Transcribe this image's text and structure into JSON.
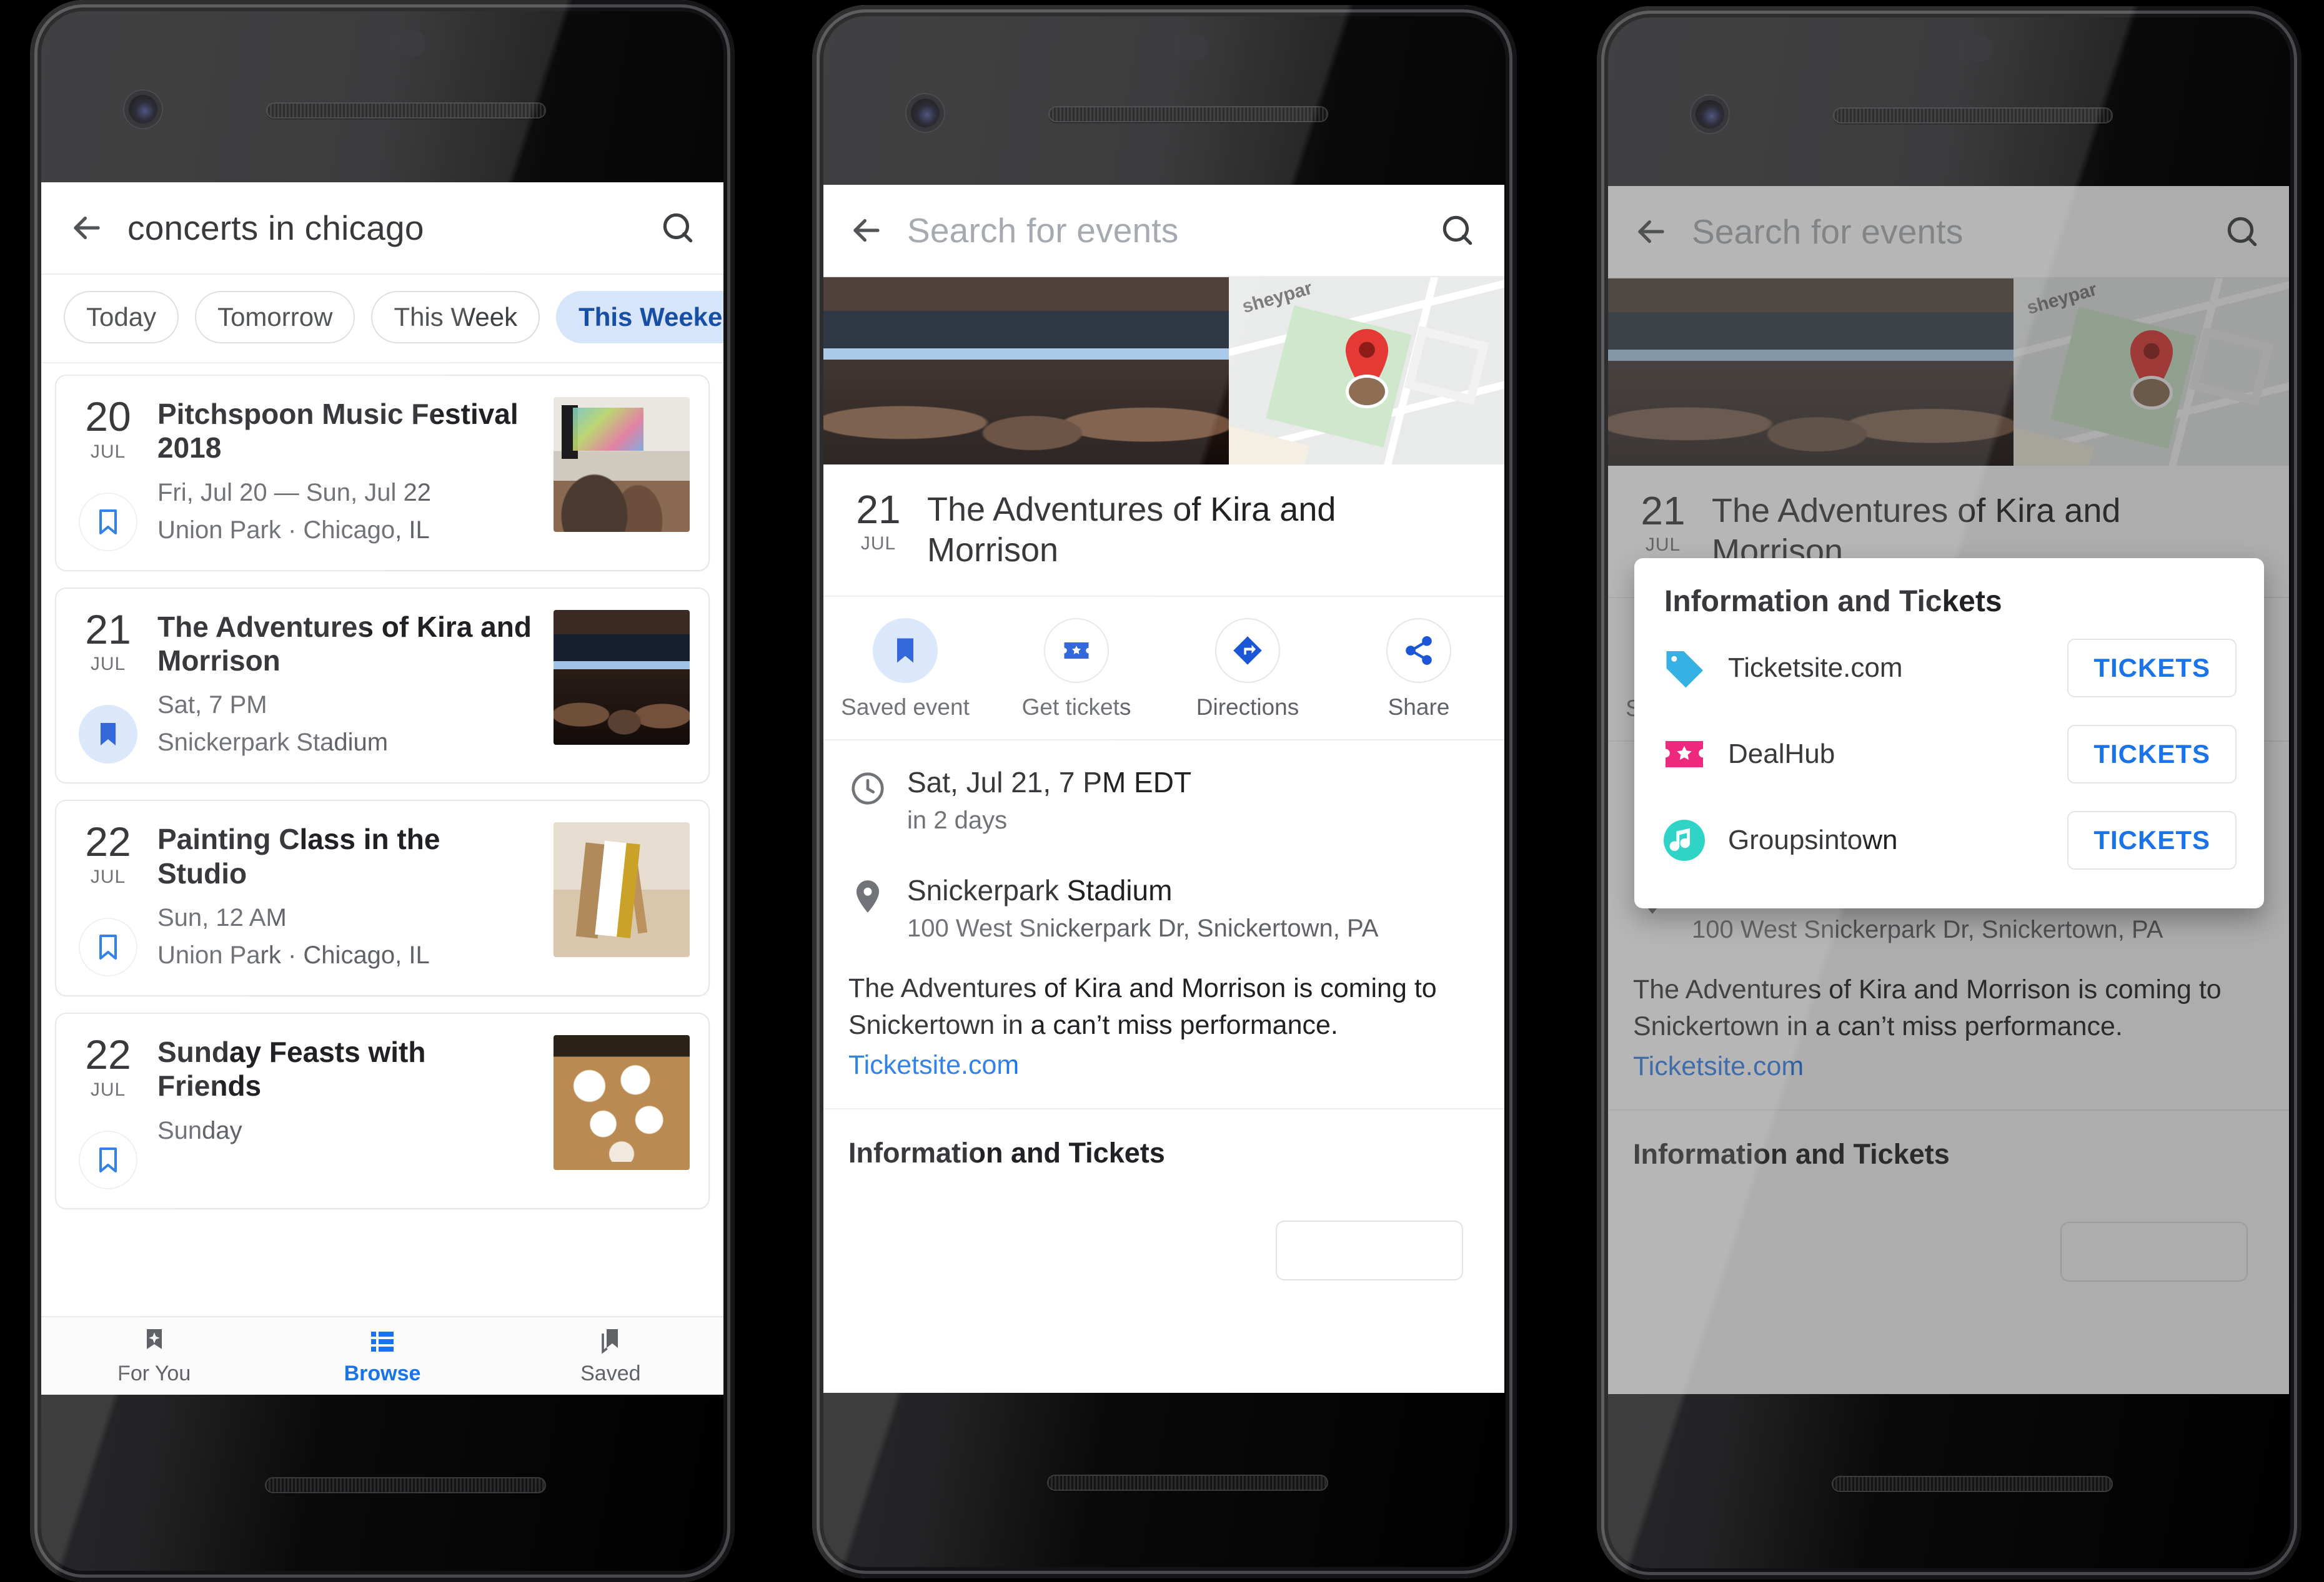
{
  "phone1": {
    "search": {
      "value": "concerts in chicago",
      "back_icon": "back-arrow-icon",
      "search_icon": "search-icon"
    },
    "filters": [
      {
        "label": "Today",
        "selected": false
      },
      {
        "label": "Tomorrow",
        "selected": false
      },
      {
        "label": "This Week",
        "selected": false
      },
      {
        "label": "This Weekend",
        "selected": true
      }
    ],
    "events": [
      {
        "day": "20",
        "month": "JUL",
        "title": "Pitchspoon Music Festival 2018",
        "line1": "Fri, Jul 20 — Sun, Jul 22",
        "line2": "Union Park · Chicago, IL",
        "saved": false,
        "photo": "music-festival-crowd"
      },
      {
        "day": "21",
        "month": "JUL",
        "title": "The Adventures of Kira and Morrison",
        "line1": "Sat, 7 PM",
        "line2": "Snickerpark Stadium",
        "saved": true,
        "photo": "theatre-audience"
      },
      {
        "day": "22",
        "month": "JUL",
        "title": "Painting Class in the Studio",
        "line1": "Sun, 12 AM",
        "line2": "Union Park · Chicago, IL",
        "saved": false,
        "photo": "painting-studio"
      },
      {
        "day": "22",
        "month": "JUL",
        "title": "Sunday Feasts with Friends",
        "line1": "Sunday",
        "line2": "",
        "saved": false,
        "photo": "dinner-table"
      }
    ],
    "bottom_nav": [
      {
        "label": "For You",
        "icon": "sparkle-bookmark-icon",
        "active": false
      },
      {
        "label": "Browse",
        "icon": "list-icon",
        "active": true
      },
      {
        "label": "Saved",
        "icon": "bookmarks-icon",
        "active": false
      }
    ]
  },
  "detail": {
    "search_placeholder": "Search for events",
    "map_label": "sheypar",
    "day": "21",
    "month": "JUL",
    "title": "The Adventures of Kira and Morrison",
    "actions": [
      {
        "label": "Saved event",
        "icon": "bookmark-filled-icon",
        "active": true
      },
      {
        "label": "Get tickets",
        "icon": "ticket-star-icon",
        "active": false
      },
      {
        "label": "Directions",
        "icon": "directions-arrow-icon",
        "active": false
      },
      {
        "label": "Share",
        "icon": "share-icon",
        "active": false
      }
    ],
    "when": {
      "icon": "clock-icon",
      "main": "Sat, Jul 21, 7 PM EDT",
      "sub": "in 2 days"
    },
    "where": {
      "icon": "location-pin-icon",
      "main": "Snickerpark Stadium",
      "sub": "100 West Snickerpark Dr, Snickertown, PA"
    },
    "description": "The Adventures of Kira and Morrison is coming to Snickertown in a can’t miss performance.",
    "description_link": "Ticketsite.com",
    "section_title": "Information and Tickets"
  },
  "dialog": {
    "title": "Information and Tickets",
    "providers": [
      {
        "name": "Ticketsite.com",
        "icon": "price-tag-icon",
        "icon_color": "#1CA7E0",
        "button": "TICKETS"
      },
      {
        "name": "DealHub",
        "icon": "ticket-star-icon",
        "icon_color": "#EC0E6E",
        "button": "TICKETS"
      },
      {
        "name": "Groupsintown",
        "icon": "music-note-icon",
        "icon_color": "#17CFC0",
        "button": "TICKETS"
      }
    ]
  },
  "colors": {
    "accent_blue": "#1a73e8",
    "chip_selected_bg": "#d7e5fb",
    "chip_selected_text": "#174ea6",
    "text_primary": "#202124",
    "text_secondary": "#5f6368",
    "map_pin_red": "#e53935"
  }
}
